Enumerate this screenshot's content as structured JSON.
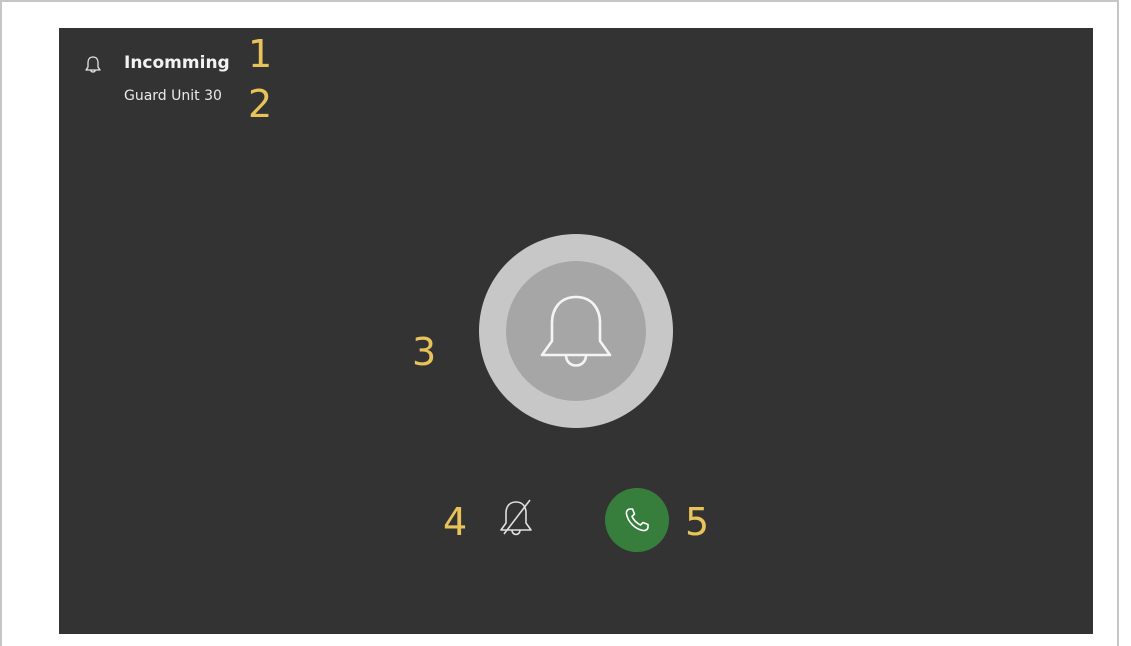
{
  "header": {
    "title": "Incomming",
    "subtitle": "Guard Unit 30",
    "icon": "bell-icon"
  },
  "main": {
    "status_icon": "bell-icon"
  },
  "actions": {
    "mute_icon": "bell-off-icon",
    "answer_icon": "phone-icon"
  },
  "callouts": [
    "1",
    "2",
    "3",
    "4",
    "5"
  ],
  "colors": {
    "background": "#333333",
    "ring_outer": "#c7c7c7",
    "ring_inner": "#a6a6a6",
    "answer": "#377e3d",
    "callout": "#e8c35a"
  }
}
